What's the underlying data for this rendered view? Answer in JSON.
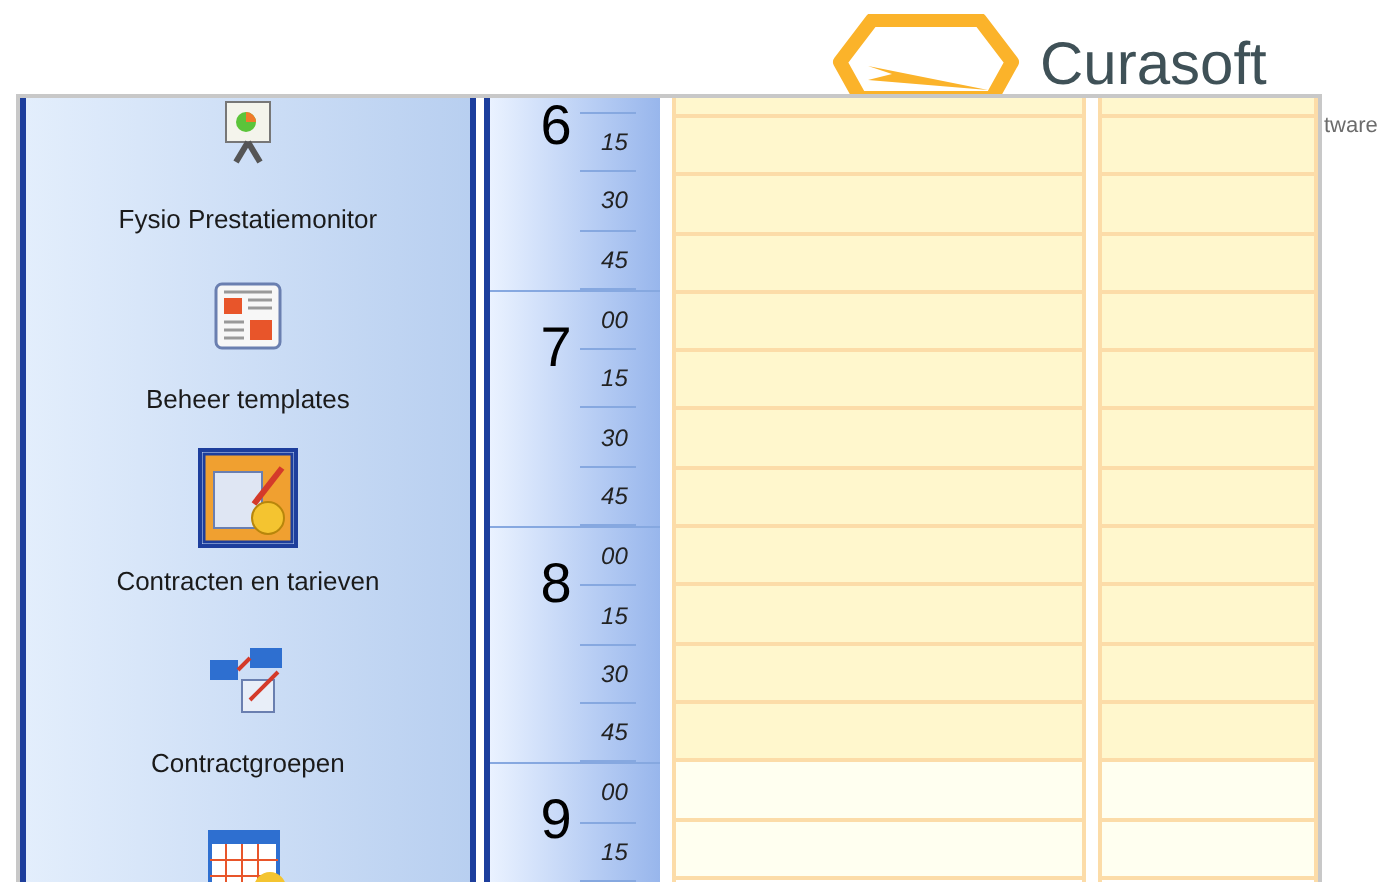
{
  "background_page": {
    "logo_text": "Curasoft",
    "tagline_fragment": "tware"
  },
  "sidebar": {
    "items": [
      {
        "kind": "presentation",
        "label": "Fysio Prestatiemonitor",
        "selected": false
      },
      {
        "kind": "templates",
        "label": "Beheer templates",
        "selected": false
      },
      {
        "kind": "contracts",
        "label": "Contracten en tarieven",
        "selected": true
      },
      {
        "kind": "groups",
        "label": "Contractgroepen",
        "selected": false
      },
      {
        "kind": "rates",
        "selected": false
      }
    ]
  },
  "time_ruler": [
    {
      "hour": "6",
      "minutes": [
        "15",
        "30",
        "45"
      ]
    },
    {
      "hour": "7",
      "minutes": [
        "00",
        "15",
        "30",
        "45"
      ]
    },
    {
      "hour": "8",
      "minutes": [
        "00",
        "15",
        "30",
        "45"
      ]
    },
    {
      "hour": "9",
      "minutes": [
        "00",
        "15"
      ]
    }
  ],
  "day_columns": [
    {
      "slots": [
        {
          "working": true
        },
        {
          "working": true
        },
        {
          "working": true
        },
        {
          "working": true
        },
        {
          "working": true
        },
        {
          "working": true
        },
        {
          "working": true
        },
        {
          "working": true
        },
        {
          "working": true
        },
        {
          "working": true
        },
        {
          "working": true
        },
        {
          "working": true
        },
        {
          "working": false
        },
        {
          "working": false
        }
      ]
    },
    {
      "slots": [
        {
          "working": true
        },
        {
          "working": true
        },
        {
          "working": true
        },
        {
          "working": true
        },
        {
          "working": true
        },
        {
          "working": true
        },
        {
          "working": true
        },
        {
          "working": true
        },
        {
          "working": true
        },
        {
          "working": true
        },
        {
          "working": true
        },
        {
          "working": true
        },
        {
          "working": false
        },
        {
          "working": false
        }
      ]
    }
  ]
}
